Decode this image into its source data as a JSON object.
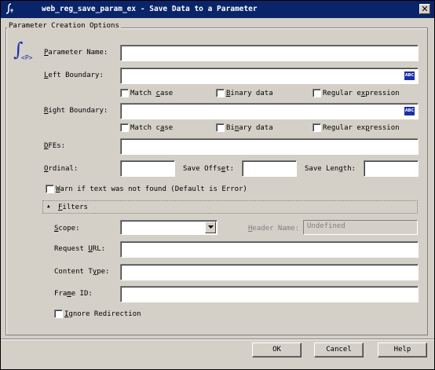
{
  "window": {
    "title": "web_reg_save_param_ex - Save Data to a Parameter",
    "close_glyph": "✕"
  },
  "group": {
    "legend": "Parameter Creation Options"
  },
  "icon": {
    "glyph": "∫",
    "sub": "<P>"
  },
  "fields": {
    "parameter_name": {
      "label_u": "P",
      "label_rest": "arameter Name:",
      "value": ""
    },
    "left_boundary": {
      "label_u": "L",
      "label_rest": "eft Boundary:",
      "value": "",
      "abc": "ABC"
    },
    "right_boundary": {
      "label_u": "R",
      "label_rest": "ight Boundary:",
      "value": "",
      "abc": "ABC"
    },
    "dfes": {
      "label_u": "D",
      "label_rest": "FEs:",
      "value": ""
    },
    "ordinal": {
      "label_u": "O",
      "label_rest": "rdinal:",
      "value": ""
    },
    "save_offset": {
      "label_pre": "Save Offs",
      "label_u": "e",
      "label_rest": "t:",
      "value": ""
    },
    "save_length": {
      "label_pre": "Save Len",
      "label_u": "g",
      "label_rest": "th:",
      "value": ""
    }
  },
  "left_checks": {
    "match_case": {
      "pre": "Match ",
      "u": "c",
      "rest": "ase",
      "checked": false
    },
    "binary_data": {
      "pre": "",
      "u": "B",
      "rest": "inary data",
      "checked": false
    },
    "regex": {
      "pre": "Regular e",
      "u": "x",
      "rest": "pression",
      "checked": false
    }
  },
  "right_checks": {
    "match_case": {
      "pre": "Match c",
      "u": "a",
      "rest": "se",
      "checked": false
    },
    "binary_data": {
      "pre": "Bi",
      "u": "n",
      "rest": "ary data",
      "checked": false
    },
    "regex": {
      "pre": "Regular ex",
      "u": "p",
      "rest": "ression",
      "checked": false
    }
  },
  "warn": {
    "u": "W",
    "rest": "arn if text was not found (Default is Error)",
    "checked": false
  },
  "filters": {
    "toggle_glyph": "▲",
    "u": "F",
    "rest": "ilters",
    "scope": {
      "pre": "",
      "u": "S",
      "rest": "cope:",
      "value": ""
    },
    "header_name": {
      "u": "H",
      "rest": "eader Name:",
      "value": "Undefined"
    },
    "request_url": {
      "pre": "Request ",
      "u": "U",
      "rest": "RL:",
      "value": ""
    },
    "content_type": {
      "pre": "Content T",
      "u": "y",
      "rest": "pe:",
      "value": ""
    },
    "frame_id": {
      "pre": "Fra",
      "u": "m",
      "rest": "e ID:",
      "value": ""
    },
    "ignore_redirection": {
      "u": "I",
      "rest": "gnore Redirection",
      "checked": false
    }
  },
  "buttons": {
    "ok": "OK",
    "cancel": "Cancel",
    "help": "Help"
  },
  "colors": {
    "titlebar": "#0a246a",
    "dialog_bg": "#d4d0c8",
    "abc_badge": "#1a2fa8"
  }
}
